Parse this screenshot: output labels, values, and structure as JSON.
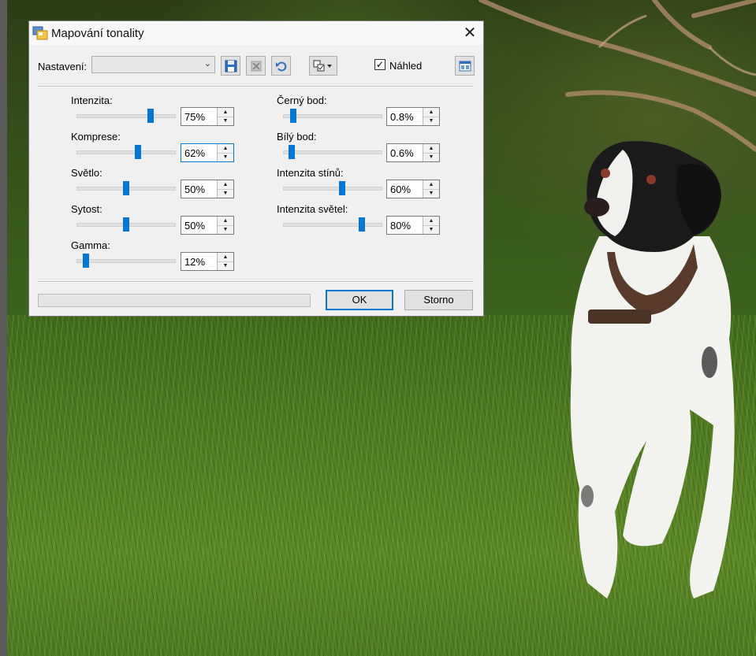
{
  "dialog": {
    "title": "Mapování tonality",
    "preset_label": "Nastavení:",
    "preset_value": "",
    "preview_label": "Náhled",
    "preview_checked": true,
    "ok_label": "OK",
    "cancel_label": "Storno",
    "progress": 0
  },
  "sliders_left": [
    {
      "label": "Intenzita:",
      "value": "75%",
      "level": 0.75
    },
    {
      "label": "Komprese:",
      "value": "62%",
      "level": 0.62
    },
    {
      "label": "Světlo:",
      "value": "50%",
      "level": 0.5
    },
    {
      "label": "Sytost:",
      "value": "50%",
      "level": 0.5
    },
    {
      "label": "Gamma:",
      "value": "12%",
      "level": 0.09
    }
  ],
  "sliders_right": [
    {
      "label": "Černý bod:",
      "value": "0.8%",
      "level": 0.1
    },
    {
      "label": "Bílý bod:",
      "value": "0.6%",
      "level": 0.08
    },
    {
      "label": "Intenzita stínů:",
      "value": "60%",
      "level": 0.6
    },
    {
      "label": "Intenzita světel:",
      "value": "80%",
      "level": 0.8
    }
  ],
  "icons": {
    "app": "app-icon",
    "close": "close-icon",
    "save": "save-icon",
    "delete": "delete-preset-icon",
    "undo": "undo-icon",
    "options": "checklist-menu-icon",
    "compare": "compare-view-icon"
  },
  "colors": {
    "accent": "#0078d7",
    "dialog_bg": "#f0f0f0"
  }
}
